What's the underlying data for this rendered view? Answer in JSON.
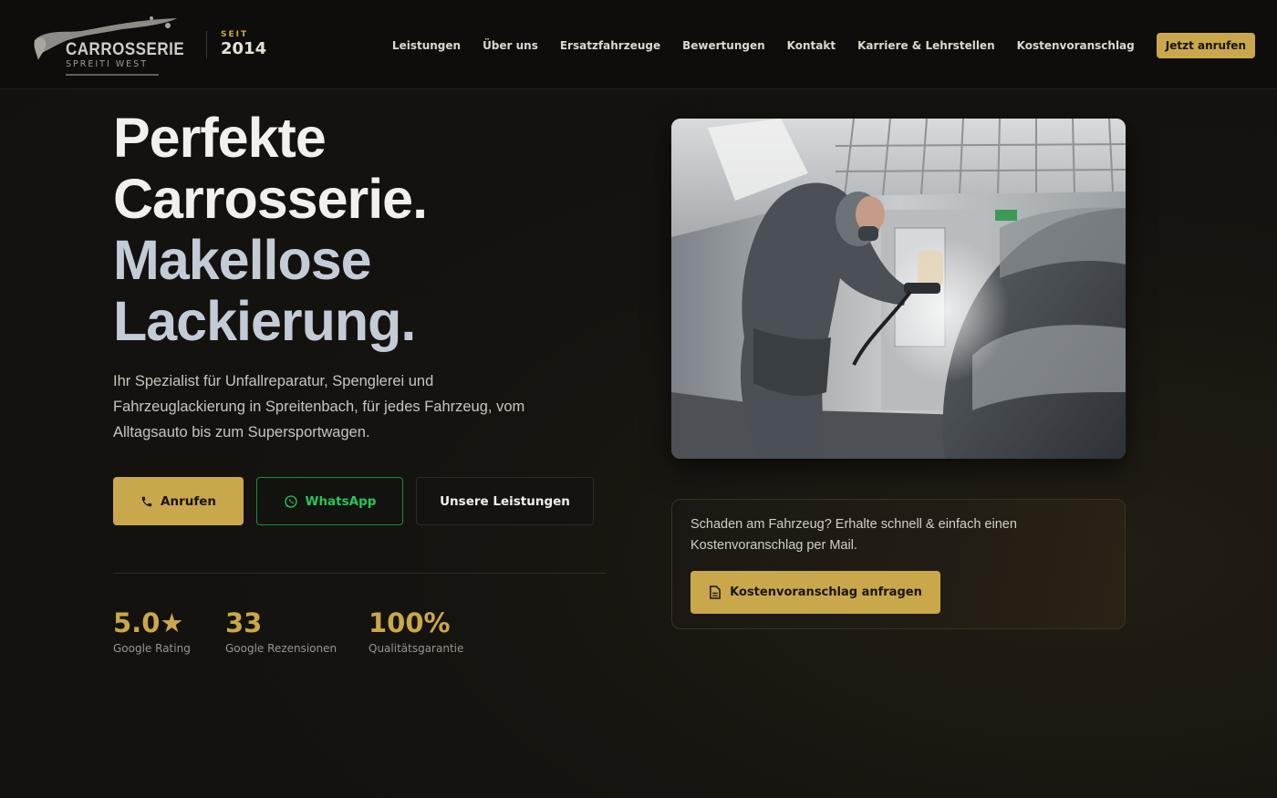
{
  "brand": {
    "logo_text": "CARROSSERIE",
    "logo_subtext": "SPREITI WEST",
    "since_label": "SEIT",
    "since_year": "2014"
  },
  "nav": {
    "items": [
      {
        "label": "Leistungen"
      },
      {
        "label": "Über uns"
      },
      {
        "label": "Ersatzfahrzeuge"
      },
      {
        "label": "Bewertungen"
      },
      {
        "label": "Kontakt"
      },
      {
        "label": "Karriere & Lehrstellen"
      },
      {
        "label": "Kostenvoranschlag"
      }
    ],
    "cta_label": "Jetzt anrufen"
  },
  "hero": {
    "headline_line1": "Perfekte Carrosserie.",
    "headline_line2": "Makellose Lackierung.",
    "lead": "Ihr Spezialist für Unfallreparatur, Spenglerei und Fahrzeuglackierung in Spreitenbach, für jedes Fahrzeug, vom Alltagsauto bis zum Supersportwagen.",
    "buttons": {
      "call": "Anrufen",
      "whatsapp": "WhatsApp",
      "services": "Unsere Leistungen"
    },
    "stats": [
      {
        "value": "5.0★",
        "label": "Google Rating"
      },
      {
        "value": "33",
        "label": "Google Rezensionen"
      },
      {
        "value": "100%",
        "label": "Qualitätsgarantie"
      }
    ]
  },
  "quote": {
    "text": "Schaden am Fahrzeug? Erhalte schnell & einfach einen Kostenvoranschlag per Mail.",
    "button": "Kostenvoranschlag anfragen"
  },
  "colors": {
    "accent": "#c9a84c",
    "whatsapp": "#29c45a",
    "background": "#121110"
  }
}
